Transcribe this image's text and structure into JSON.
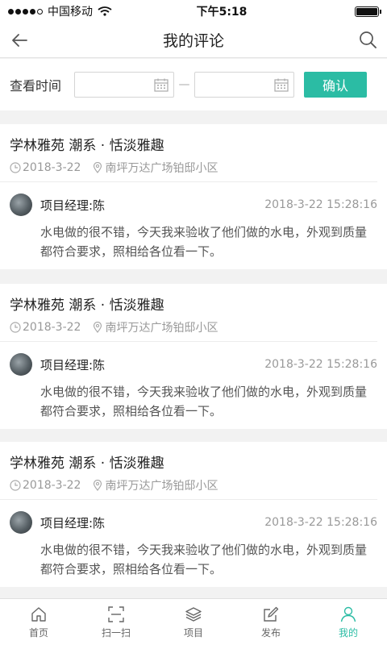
{
  "status": {
    "carrier": "中国移动",
    "time": "下午5:18"
  },
  "nav": {
    "title": "我的评论"
  },
  "filter": {
    "label": "查看时间",
    "start_value": "",
    "end_value": "",
    "separator": "—",
    "confirm": "确认"
  },
  "cards": [
    {
      "title": "学林雅苑  潮系 · 恬淡雅趣",
      "date": "2018-3-22",
      "location": "南坪万达广场铂邸小区",
      "author": "项目经理:陈",
      "time": "2018-3-22  15:28:16",
      "text": "水电做的很不错，今天我来验收了他们做的水电，外观到质量都符合要求，照相给各位看一下。"
    },
    {
      "title": "学林雅苑  潮系 · 恬淡雅趣",
      "date": "2018-3-22",
      "location": "南坪万达广场铂邸小区",
      "author": "项目经理:陈",
      "time": "2018-3-22  15:28:16",
      "text": "水电做的很不错，今天我来验收了他们做的水电，外观到质量都符合要求，照相给各位看一下。"
    },
    {
      "title": "学林雅苑  潮系 · 恬淡雅趣",
      "date": "2018-3-22",
      "location": "南坪万达广场铂邸小区",
      "author": "项目经理:陈",
      "time": "2018-3-22  15:28:16",
      "text": "水电做的很不错，今天我来验收了他们做的水电，外观到质量都符合要求，照相给各位看一下。"
    }
  ],
  "tabs": [
    {
      "label": "首页",
      "icon": "home-icon"
    },
    {
      "label": "扫一扫",
      "icon": "scan-icon"
    },
    {
      "label": "项目",
      "icon": "layers-icon"
    },
    {
      "label": "发布",
      "icon": "edit-icon"
    },
    {
      "label": "我的",
      "icon": "user-icon",
      "active": true
    }
  ],
  "colors": {
    "accent": "#2bbca4"
  }
}
